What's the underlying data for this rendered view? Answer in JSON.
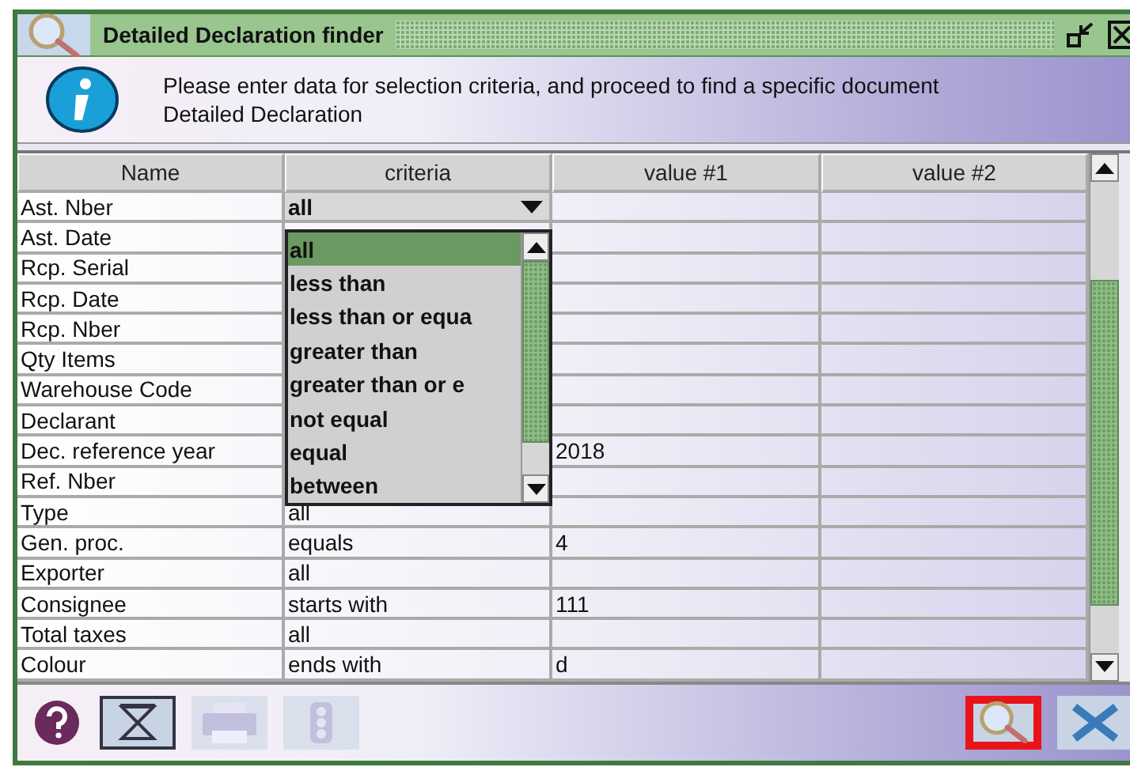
{
  "window": {
    "title": "Detailed Declaration finder"
  },
  "info": {
    "message": "Please enter data for selection criteria, and proceed to find a specific document Detailed Declaration"
  },
  "table": {
    "columns": [
      "Name",
      "criteria",
      "value #1",
      "value #2"
    ],
    "rows": [
      {
        "name": "Ast. Nber",
        "criteria": "all",
        "kind": "combo"
      },
      {
        "name": "Ast. Date"
      },
      {
        "name": "Rcp. Serial"
      },
      {
        "name": "Rcp. Date"
      },
      {
        "name": "Rcp. Nber"
      },
      {
        "name": "Qty Items"
      },
      {
        "name": "Warehouse Code"
      },
      {
        "name": "Declarant"
      },
      {
        "name": "Dec. reference year",
        "value_1": "2018"
      },
      {
        "name": "Ref. Nber"
      },
      {
        "name": "Type",
        "criteria": "all"
      },
      {
        "name": "Gen. proc.",
        "criteria": "equals",
        "value_1": "4"
      },
      {
        "name": "Exporter",
        "criteria": "all"
      },
      {
        "name": "Consignee",
        "criteria": "starts with",
        "value_1": "111"
      },
      {
        "name": "Total taxes",
        "criteria": "all"
      },
      {
        "name": "Colour",
        "criteria": "ends with",
        "value_1": "d"
      }
    ]
  },
  "dropdown": {
    "options": [
      {
        "label": "all",
        "selected": true
      },
      {
        "label": "less than",
        "selected": false
      },
      {
        "label": "less than or equa",
        "selected": false
      },
      {
        "label": "greater than",
        "selected": false
      },
      {
        "label": "greater than or e",
        "selected": false
      },
      {
        "label": "not equal",
        "selected": false
      },
      {
        "label": "equal",
        "selected": false
      },
      {
        "label": "between",
        "selected": false
      }
    ]
  },
  "toolbar": {
    "left": [
      {
        "kind": "help",
        "disabled": false
      },
      {
        "kind": "filter",
        "disabled": false
      },
      {
        "kind": "print",
        "disabled": true
      },
      {
        "kind": "lights",
        "disabled": true
      }
    ],
    "right": [
      {
        "kind": "search",
        "disabled": false,
        "highlighted": true
      },
      {
        "kind": "close",
        "disabled": false,
        "highlighted": false
      }
    ]
  }
}
